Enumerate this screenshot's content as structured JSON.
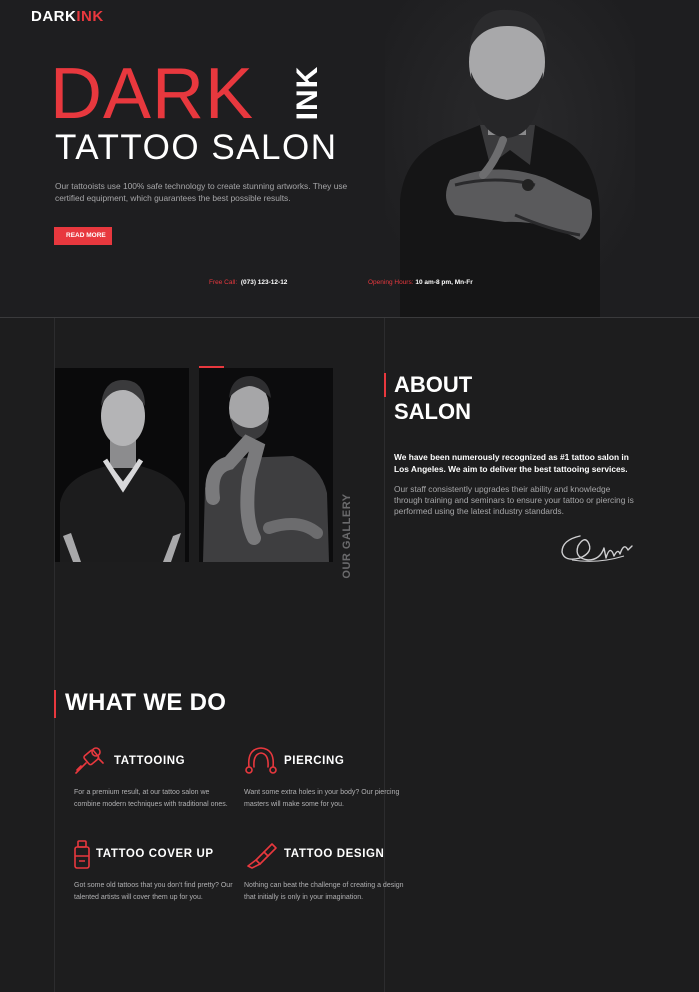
{
  "colors": {
    "accent": "#e8383e",
    "background": "#1d1d1e",
    "text_muted": "#a6a6a8"
  },
  "header": {
    "logo_dark": "DARK",
    "logo_ink": "INK",
    "menu_icon": "hamburger-menu-icon"
  },
  "hero": {
    "title_dark": "DARK",
    "title_ink": "INK",
    "subtitle": "TATTOO SALON",
    "description": "Our tattooists use 100% safe technology to create stunning artworks. They use certified equipment, which guarantees the best possible results.",
    "cta_label": "READ MORE",
    "free_call_label": "Free Call:",
    "free_call_value": "(073) 123-12-12",
    "hours_label": "Opening Hours:",
    "hours_value": "10 am-8 pm, Mn-Fr"
  },
  "gallery": {
    "label": "OUR GALLERY"
  },
  "about": {
    "title_line1": "ABOUT",
    "title_line2": "SALON",
    "lead": "We have been numerously recognized as #1 tattoo salon in Los Angeles. We aim to deliver the best tattooing services.",
    "text": "Our staff consistently upgrades their ability and knowledge through training and seminars to ensure your tattoo or piercing is performed using the latest industry standards."
  },
  "services": {
    "title": "WHAT WE DO",
    "items": [
      {
        "icon": "tattoo-machine-icon",
        "title": "TATTOOING",
        "description": "For a premium result, at our tattoo salon we combine modern techniques with traditional ones."
      },
      {
        "icon": "piercing-ring-icon",
        "title": "PIERCING",
        "description": "Want some extra holes in your body? Our piercing masters will make some for you."
      },
      {
        "icon": "ink-bottle-icon",
        "title": "TATTOO COVER UP",
        "description": "Got some old tattoos that you don't find pretty? Our talented artists will cover them up for you."
      },
      {
        "icon": "design-brush-icon",
        "title": "TATTOO DESIGN",
        "description": "Nothing can beat the challenge of creating a design that initially is only in your imagination."
      }
    ]
  }
}
